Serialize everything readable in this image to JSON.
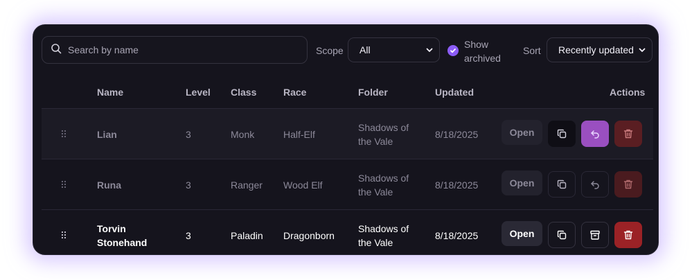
{
  "toolbar": {
    "search_placeholder": "Search by name",
    "scope_label": "Scope",
    "scope_value": "All",
    "show_archived_label": "Show archived",
    "show_archived_checked": true,
    "sort_label": "Sort",
    "sort_value": "Recently updated"
  },
  "table": {
    "columns": [
      "Name",
      "Level",
      "Class",
      "Race",
      "Folder",
      "Updated",
      "Actions"
    ],
    "rows": [
      {
        "name": "Lian",
        "level": "3",
        "class": "Monk",
        "race": "Half-Elf",
        "folder": "Shadows of the Vale",
        "updated": "8/18/2025",
        "open_label": "Open",
        "archived": true
      },
      {
        "name": "Runa",
        "level": "3",
        "class": "Ranger",
        "race": "Wood Elf",
        "folder": "Shadows of the Vale",
        "updated": "8/18/2025",
        "open_label": "Open",
        "archived": true
      },
      {
        "name": "Torvin Stonehand",
        "level": "3",
        "class": "Paladin",
        "race": "Dragonborn",
        "folder": "Shadows of the Vale",
        "updated": "8/18/2025",
        "open_label": "Open",
        "archived": false
      }
    ]
  },
  "colors": {
    "accent": "#8b5cf6",
    "restore_active": "#9a4fc0",
    "delete_dim": "#5a1e22",
    "delete_active": "#9b2226"
  },
  "icons": {
    "search": "search-icon",
    "grip": "drag-handle-icon",
    "copy": "copy-icon",
    "restore": "undo-icon",
    "archive": "archive-icon",
    "delete": "trash-icon",
    "chevron": "chevron-down-icon",
    "check": "check-icon"
  }
}
